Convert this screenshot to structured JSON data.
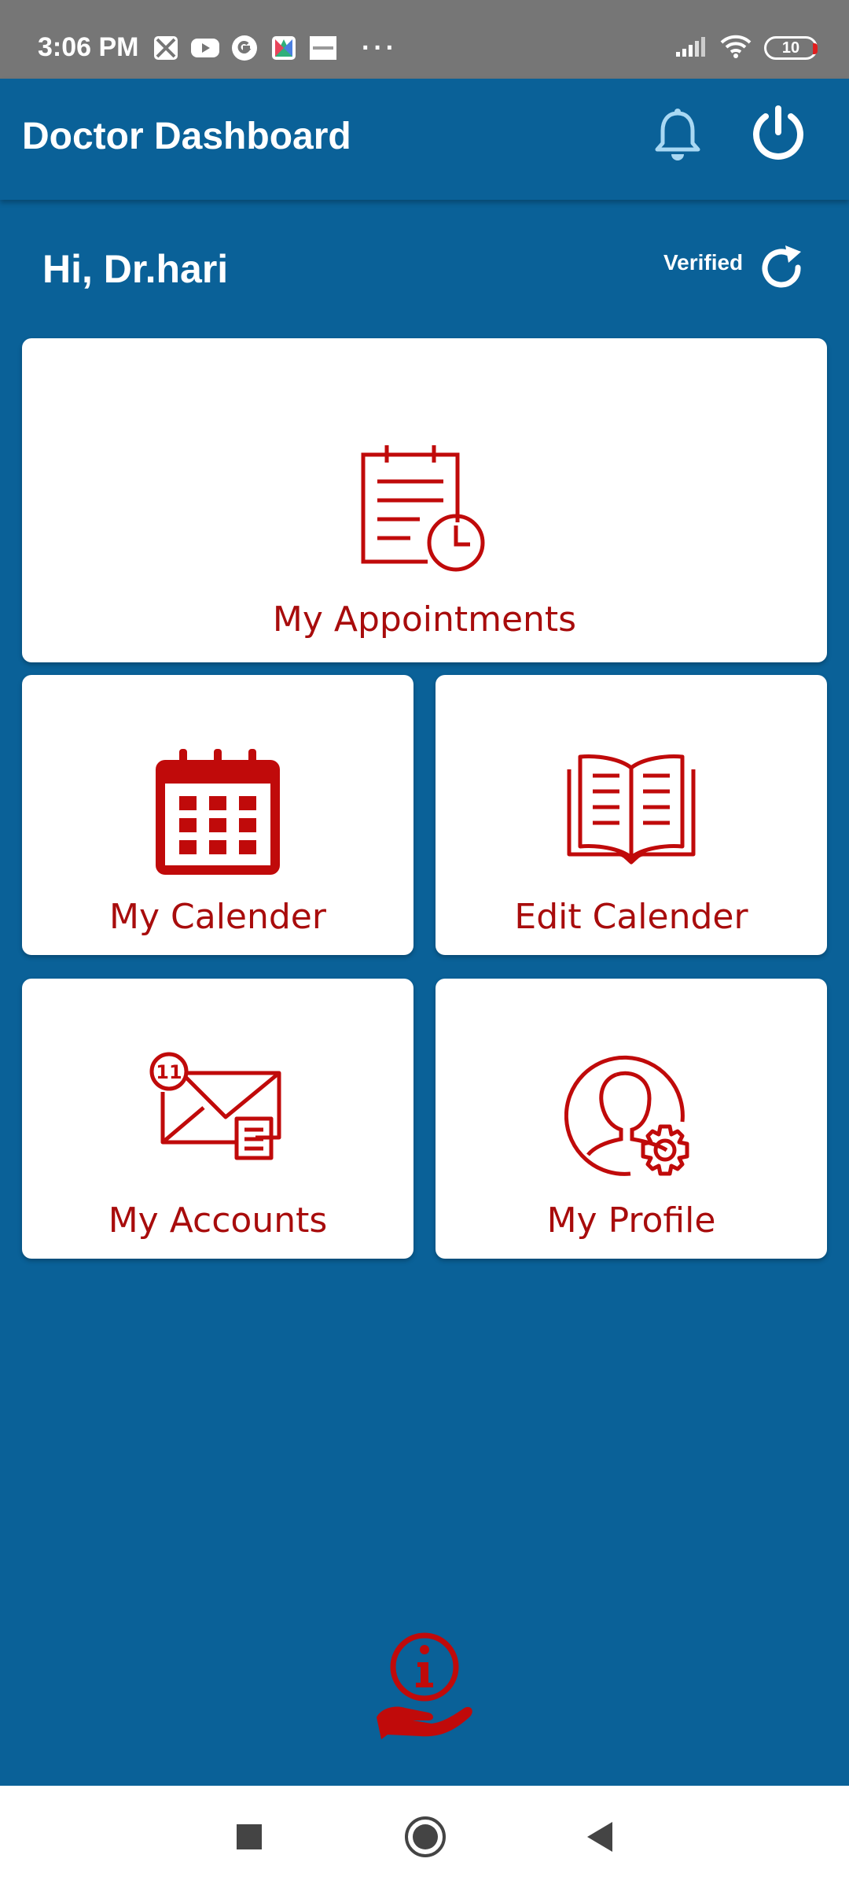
{
  "status_bar": {
    "time": "3:06 PM",
    "notification_icons": [
      "maps-icon",
      "youtube-icon",
      "google-icon",
      "app-icon",
      "zomato-icon"
    ],
    "more": "···",
    "battery": "10"
  },
  "app_bar": {
    "title": "Doctor Dashboard"
  },
  "greeting": {
    "text": "Hi, Dr.hari",
    "status": "Verified"
  },
  "cards": {
    "appointments": "My Appointments",
    "calendar": "My Calender",
    "edit_calendar": "Edit Calender",
    "accounts": "My Accounts",
    "accounts_badge": "11",
    "profile": "My Profile"
  },
  "colors": {
    "primary": "#0a6198",
    "accent": "#a80c0c",
    "card": "#ffffff"
  }
}
